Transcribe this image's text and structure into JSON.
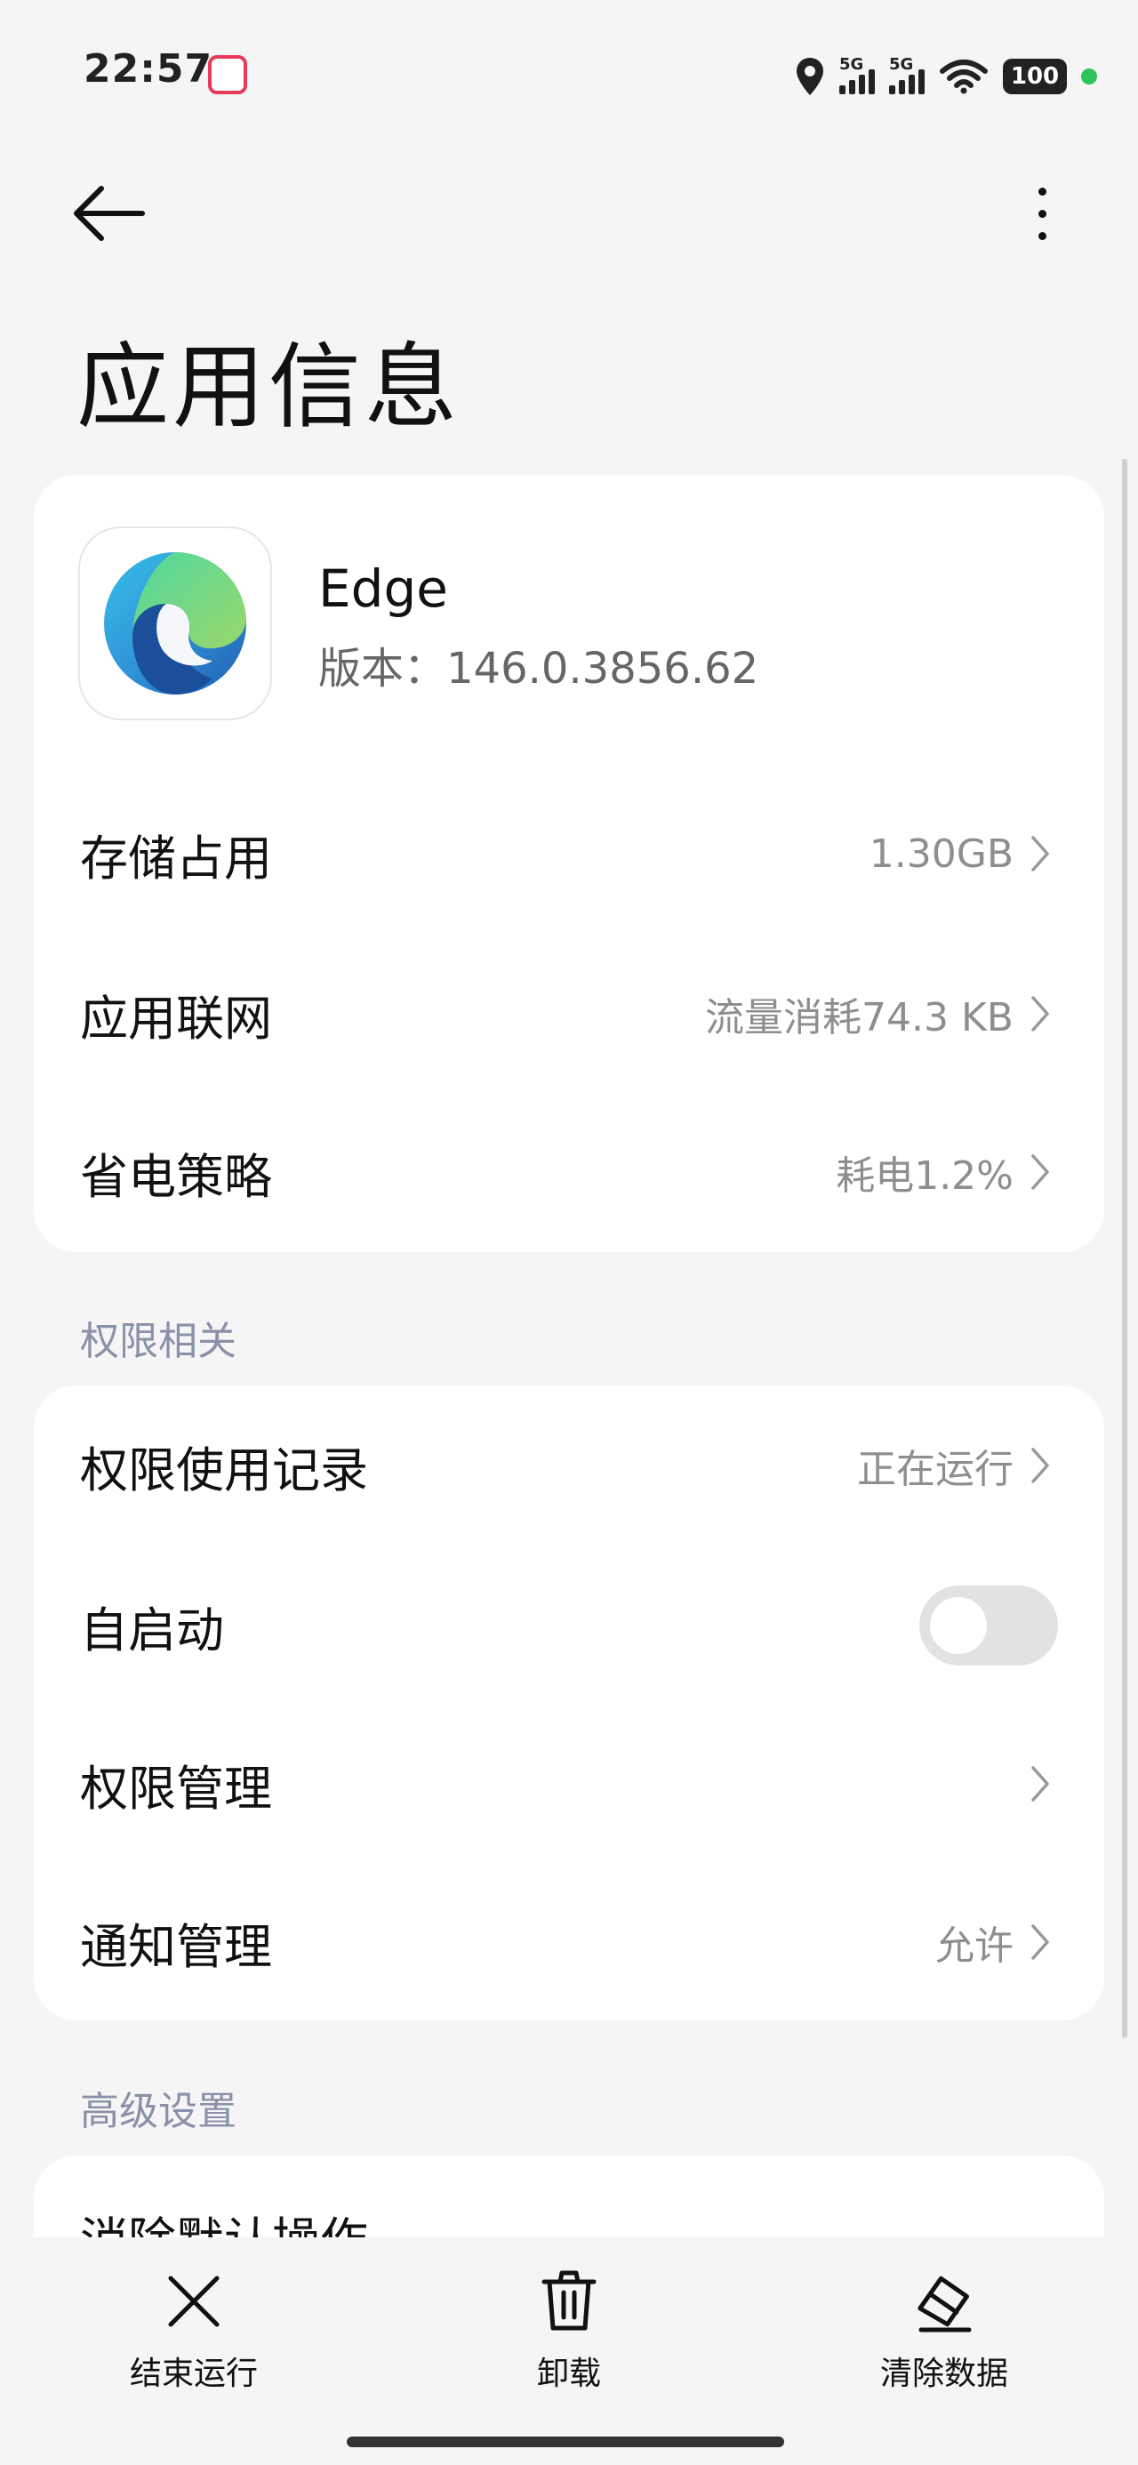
{
  "status_bar": {
    "time": "22:57",
    "signal1_tag": "5G",
    "signal2_tag": "5G",
    "battery": "100",
    "icons": [
      "location-icon",
      "signal-icon",
      "signal-icon",
      "wifi-icon",
      "battery-icon"
    ]
  },
  "header": {
    "title": "应用信息"
  },
  "app": {
    "name": "Edge",
    "version": "版本：146.0.3856.62"
  },
  "usage_rows": [
    {
      "label": "存储占用",
      "value": "1.30GB"
    },
    {
      "label": "应用联网",
      "value": "流量消耗74.3 KB"
    },
    {
      "label": "省电策略",
      "value": "耗电1.2%"
    }
  ],
  "permissions": {
    "section_title": "权限相关",
    "rows": [
      {
        "label": "权限使用记录",
        "value": "正在运行"
      },
      {
        "label": "自启动",
        "toggle_on": false
      },
      {
        "label": "权限管理",
        "value": ""
      },
      {
        "label": "通知管理",
        "value": "允许"
      }
    ]
  },
  "advanced": {
    "section_title": "高级设置",
    "partial_row": "消除默认操作"
  },
  "bottom_bar": {
    "items": [
      {
        "label": "结束运行",
        "icon": "close-icon"
      },
      {
        "label": "卸载",
        "icon": "trash-icon"
      },
      {
        "label": "清除数据",
        "icon": "eraser-icon"
      }
    ]
  },
  "colors": {
    "background": "#f5f5f5",
    "card": "#ffffff",
    "section_header": "#8891a8",
    "secondary_text": "#8e8e8e"
  }
}
